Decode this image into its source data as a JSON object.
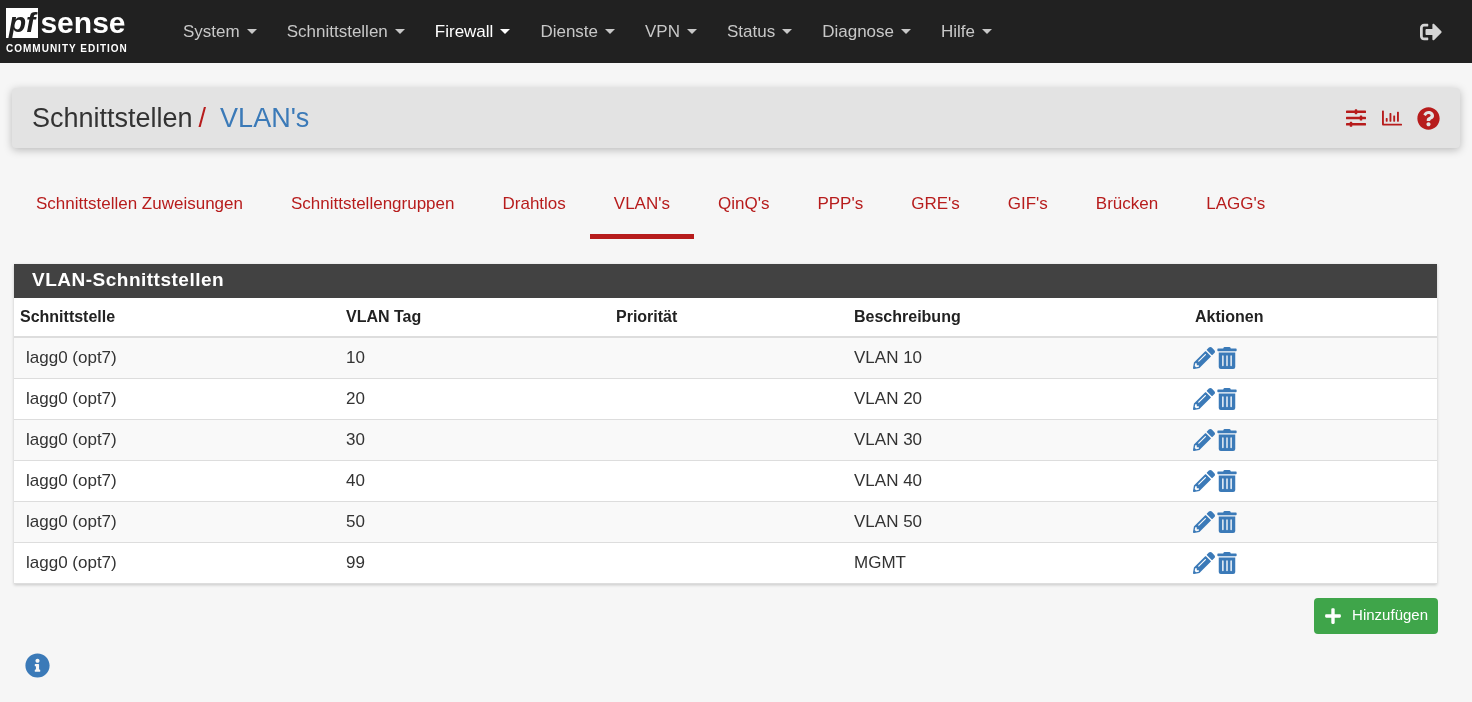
{
  "logo": {
    "mark": "pf",
    "word": "sense",
    "edition": "COMMUNITY EDITION"
  },
  "nav": [
    {
      "label": "System",
      "selected": false
    },
    {
      "label": "Schnittstellen",
      "selected": false
    },
    {
      "label": "Firewall",
      "selected": true
    },
    {
      "label": "Dienste",
      "selected": false
    },
    {
      "label": "VPN",
      "selected": false
    },
    {
      "label": "Status",
      "selected": false
    },
    {
      "label": "Diagnose",
      "selected": false
    },
    {
      "label": "Hilfe",
      "selected": false
    }
  ],
  "breadcrumb": {
    "parent": "Schnittstellen",
    "separator": "/",
    "current": "VLAN's"
  },
  "tabs": [
    {
      "label": "Schnittstellen Zuweisungen",
      "selected": false
    },
    {
      "label": "Schnittstellengruppen",
      "selected": false
    },
    {
      "label": "Drahtlos",
      "selected": false
    },
    {
      "label": "VLAN's",
      "selected": true
    },
    {
      "label": "QinQ's",
      "selected": false
    },
    {
      "label": "PPP's",
      "selected": false
    },
    {
      "label": "GRE's",
      "selected": false
    },
    {
      "label": "GIF's",
      "selected": false
    },
    {
      "label": "Brücken",
      "selected": false
    },
    {
      "label": "LAGG's",
      "selected": false
    }
  ],
  "panel": {
    "title": "VLAN-Schnittstellen",
    "columns": [
      "Schnittstelle",
      "VLAN Tag",
      "Priorität",
      "Beschreibung",
      "Aktionen"
    ],
    "rows": [
      {
        "interface": "lagg0 (opt7)",
        "tag": "10",
        "description": "VLAN 10"
      },
      {
        "interface": "lagg0 (opt7)",
        "tag": "20",
        "description": "VLAN 20"
      },
      {
        "interface": "lagg0 (opt7)",
        "tag": "30",
        "description": "VLAN 30"
      },
      {
        "interface": "lagg0 (opt7)",
        "tag": "40",
        "description": "VLAN 40"
      },
      {
        "interface": "lagg0 (opt7)",
        "tag": "50",
        "description": "VLAN 50"
      },
      {
        "interface": "lagg0 (opt7)",
        "tag": "99",
        "description": "MGMT"
      }
    ]
  },
  "add_button": "Hinzufügen"
}
